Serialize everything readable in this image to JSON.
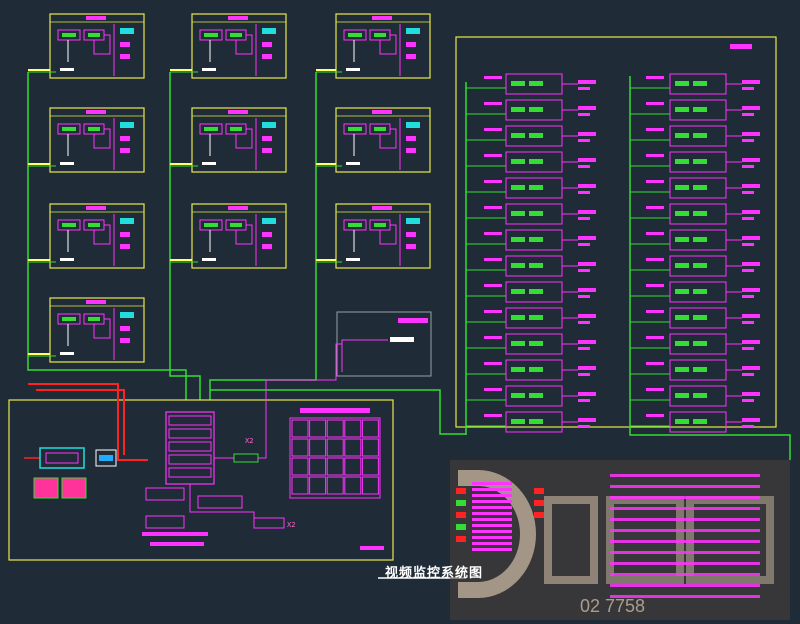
{
  "drawing": {
    "title": "视频监控系统图",
    "colors": {
      "background": "#1f2b36",
      "frame": "#e8e84a",
      "device": "#ff33ff",
      "trunk": "#33dd33",
      "power": "#ff2222",
      "gray_frame": "#9aa0a6",
      "watermark": "#c9b7a2"
    }
  },
  "labels": {
    "x2_a": "X2",
    "x2_b": "X2",
    "watermark_digits": "02                 7758"
  }
}
